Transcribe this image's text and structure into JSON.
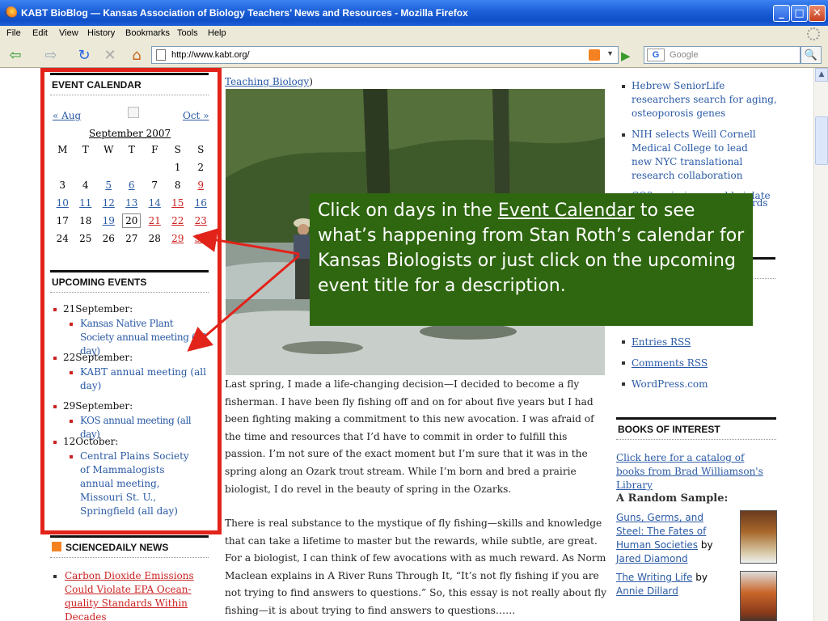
{
  "window": {
    "title": "KABT BioBlog — Kansas Association of Biology Teachers’ News and Resources - Mozilla Firefox",
    "minimize": "_",
    "maximize": "□",
    "close": "✕"
  },
  "menu": [
    "File",
    "Edit",
    "View",
    "History",
    "Bookmarks",
    "Tools",
    "Help"
  ],
  "nav": {
    "back": "⇦",
    "forward": "⇨",
    "reload": "↻",
    "stop": "✕",
    "home": "⌂",
    "url": "http://www.kabt.org/",
    "search_placeholder": "Google",
    "go": "▶",
    "search_btn": "🔍"
  },
  "left": {
    "calendar_heading": "EVENT CALENDAR",
    "prev": "« Aug",
    "next": "Oct »",
    "caption": "September 2007",
    "weekdays": [
      "M",
      "T",
      "W",
      "T",
      "F",
      "S",
      "S"
    ],
    "weeks": [
      [
        "",
        "",
        "",
        "",
        "",
        "1",
        "2"
      ],
      [
        "3",
        "4",
        "5",
        "6",
        "7",
        "8",
        "9"
      ],
      [
        "10",
        "11",
        "12",
        "13",
        "14",
        "15",
        "16"
      ],
      [
        "17",
        "18",
        "19",
        "20",
        "21",
        "22",
        "23"
      ],
      [
        "24",
        "25",
        "26",
        "27",
        "28",
        "29",
        "30"
      ]
    ],
    "upcoming_heading": "UPCOMING EVENTS",
    "events": [
      {
        "date": "21September:",
        "title": "Kansas Native Plant Society annual meeting (all day)"
      },
      {
        "date": "22September:",
        "title": "KABT annual meeting (all day)"
      },
      {
        "date": "29September:",
        "title": "KOS annual meeting (all day)"
      },
      {
        "date": "12October:",
        "title": "Central Plains Society of Mammalogists annual meeting, Missouri St. U., Springfield (all day)"
      }
    ],
    "sciencedaily_heading": "SCIENCEDAILY NEWS",
    "sciencedaily_item": "Carbon Dioxide Emissions Could Violate EPA Ocean-quality Standards Within Decades"
  },
  "main": {
    "top_link": "Teaching Biology",
    "paragraph1": "Last spring, I made a life-changing decision—I decided to become a fly fisherman. I have been fly fishing off and on for about five years but I had been fighting making a commitment to this new avocation. I was afraid of the time and resources that I’d have to commit in order to fulfill this passion. I’m not sure of the exact moment but I’m sure that it was in the spring along an Ozark trout stream. While I’m born and bred a prairie biologist, I do revel in the beauty of spring in the Ozarks.",
    "paragraph2": "There is real substance to the mystique of fly fishing—skills and knowledge that can take a lifetime to master but the rewards, while subtle, are great. For a biologist, I can think of few avocations with as much reward. As Norm Maclean explains in A River Runs Through It, “It’s not fly fishing if you are not trying to find answers to questions.” So, this essay is not really about fly fishing—it is about trying to find answers to questions……"
  },
  "right": {
    "news": [
      "Hebrew SeniorLife researchers search for aging, osteoporosis genes",
      "NIH selects Weill Cornell Medical College to lead new NYC translational research collaboration",
      "CO2 emissions could violate"
    ],
    "meta": [
      "Entries RSS",
      "Comments RSS",
      "WordPress.com"
    ],
    "books_heading": "BOOKS OF INTEREST",
    "catalog_link": "Click here for a catalog of books from Brad Williamson's Library",
    "random_sample": "A Random Sample:",
    "book1_title": "Guns, Germs, and Steel: The Fates of Human Societies",
    "by": "by",
    "book1_author": "Jared Diamond",
    "book2_title": "The Writing Life",
    "book2_author": "Annie Dillard"
  },
  "callout": {
    "before": "Click on days in the ",
    "link": "Event Calendar",
    "after": " to see what’s happening from Stan Roth’s calendar for Kansas Biologists or just click on the upcoming event title for a description."
  },
  "colors": {
    "callout_bg": "#2f6710",
    "frame_red": "#e2231a",
    "arrow_red": "#e2231a"
  }
}
